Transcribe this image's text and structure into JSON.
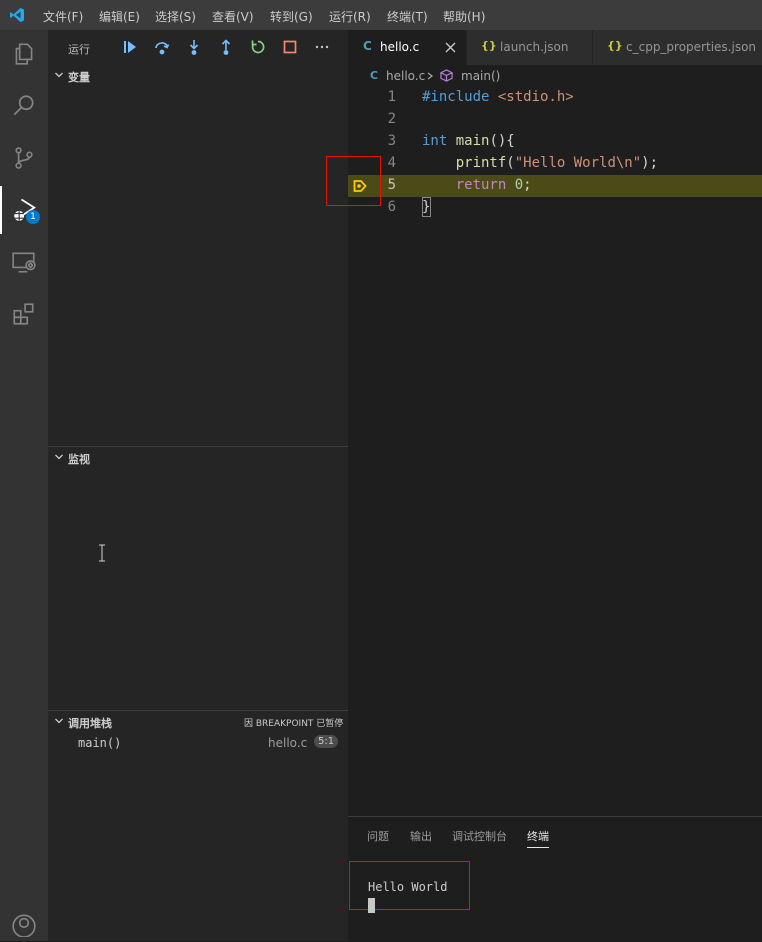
{
  "menu": [
    "文件(F)",
    "编辑(E)",
    "选择(S)",
    "查看(V)",
    "转到(G)",
    "运行(R)",
    "终端(T)",
    "帮助(H)"
  ],
  "activity_badge": "1",
  "sidebar": {
    "run_label": "运行",
    "variables_title": "变量",
    "watch_title": "监视",
    "callstack_title": "调用堆栈",
    "callstack_status": "因 BREAKPOINT 已暂停",
    "frames": [
      {
        "name": "main()",
        "file": "hello.c",
        "pos": "5:1"
      }
    ]
  },
  "tabs": [
    {
      "icon": "C",
      "label": "hello.c"
    },
    {
      "icon": "{}",
      "label": "launch.json"
    },
    {
      "icon": "{}",
      "label": "c_cpp_properties.json"
    }
  ],
  "breadcrumb": {
    "icon": "C",
    "file": "hello.c",
    "symbol": "main()"
  },
  "editor": {
    "line_numbers": [
      "1",
      "2",
      "3",
      "4",
      "5",
      "6"
    ],
    "lines": [
      {
        "parts": [
          [
            "#include ",
            "#569cd6"
          ],
          [
            "<stdio.h>",
            "#ce9178"
          ]
        ]
      },
      {
        "parts": []
      },
      {
        "parts": [
          [
            "int",
            "#569cd6"
          ],
          [
            " main",
            "#dcdcaa"
          ],
          [
            "(){",
            "#d4d4d4"
          ]
        ]
      },
      {
        "parts": [
          [
            "    printf",
            "#dcdcaa"
          ],
          [
            "(",
            "#d4d4d4"
          ],
          [
            "\"Hello World\\n\"",
            "#ce9178"
          ],
          [
            ");",
            "#d4d4d4"
          ]
        ]
      },
      {
        "parts": [
          [
            "    return",
            "#c586c0"
          ],
          [
            " ",
            "#d4d4d4"
          ],
          [
            "0",
            "#b5cea8"
          ],
          [
            ";",
            "#d4d4d4"
          ]
        ]
      },
      {
        "parts": [
          [
            "}",
            "#d4d4d4"
          ]
        ]
      }
    ]
  },
  "panel": {
    "tabs": [
      "问题",
      "输出",
      "调试控制台",
      "终端"
    ],
    "active_tab": "终端",
    "terminal_output": "Hello World"
  },
  "colors": {
    "accent": "#007acc",
    "highlight": "#4b4b18",
    "debug_arrow": "#ffcc00",
    "annotation_box": "#e51400"
  }
}
